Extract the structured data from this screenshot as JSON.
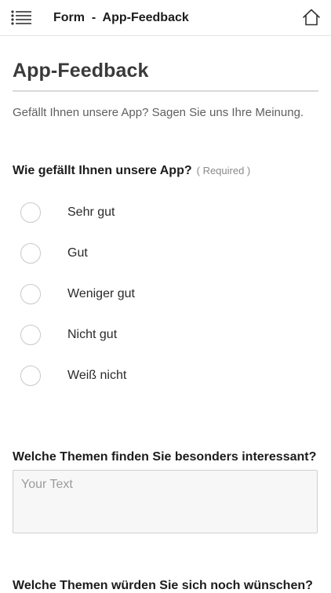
{
  "header": {
    "title": "Form  -  App-Feedback",
    "menu_icon": "list-menu-icon",
    "home_icon": "home-icon"
  },
  "page": {
    "title": "App-Feedback",
    "description": "Gefällt Ihnen unsere App? Sagen Sie uns Ihre Meinung."
  },
  "questions": [
    {
      "label": "Wie gefällt Ihnen unsere App?",
      "required": "( Required )",
      "type": "radio",
      "options": [
        "Sehr gut",
        "Gut",
        "Weniger gut",
        "Nicht gut",
        "Weiß nicht"
      ]
    },
    {
      "label": "Welche Themen finden Sie besonders interessant?",
      "type": "textarea",
      "placeholder": "Your Text",
      "value": ""
    },
    {
      "label": "Welche Themen würden Sie sich noch wünschen?",
      "type": "textarea"
    }
  ],
  "colors": {
    "text": "#1c1c1c",
    "muted": "#5f5f5f",
    "rule": "#d9d9d9",
    "field_bg": "#f7f7f8"
  }
}
